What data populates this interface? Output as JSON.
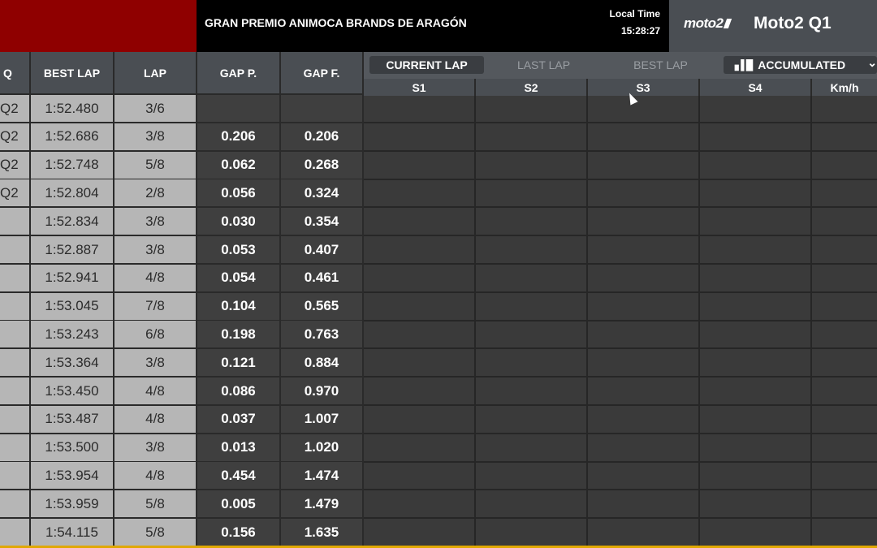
{
  "header": {
    "event_title": "GRAN PREMIO ANIMOCA BRANDS DE ARAGÓN",
    "local_time_label": "Local Time",
    "local_time_value": "15:28:27",
    "series_logo": "moto2",
    "session_title": "Moto2 Q1"
  },
  "columns": {
    "q": "Q",
    "best_lap": "BEST LAP",
    "lap": "LAP",
    "gap_p": "GAP P.",
    "gap_f": "GAP F."
  },
  "tabs": {
    "current": "CURRENT LAP",
    "last": "LAST LAP",
    "best": "BEST LAP",
    "accumulated": "ACCUMULATED"
  },
  "sectors": [
    "S1",
    "S2",
    "S3",
    "S4",
    "Km/h"
  ],
  "rows": [
    {
      "q": "Q2",
      "best": "1:52.480",
      "lap": "3/6",
      "gap_p": "",
      "gap_f": ""
    },
    {
      "q": "Q2",
      "best": "1:52.686",
      "lap": "3/8",
      "gap_p": "0.206",
      "gap_f": "0.206"
    },
    {
      "q": "Q2",
      "best": "1:52.748",
      "lap": "5/8",
      "gap_p": "0.062",
      "gap_f": "0.268"
    },
    {
      "q": "Q2",
      "best": "1:52.804",
      "lap": "2/8",
      "gap_p": "0.056",
      "gap_f": "0.324"
    },
    {
      "q": "",
      "best": "1:52.834",
      "lap": "3/8",
      "gap_p": "0.030",
      "gap_f": "0.354"
    },
    {
      "q": "",
      "best": "1:52.887",
      "lap": "3/8",
      "gap_p": "0.053",
      "gap_f": "0.407"
    },
    {
      "q": "",
      "best": "1:52.941",
      "lap": "4/8",
      "gap_p": "0.054",
      "gap_f": "0.461"
    },
    {
      "q": "",
      "best": "1:53.045",
      "lap": "7/8",
      "gap_p": "0.104",
      "gap_f": "0.565"
    },
    {
      "q": "",
      "best": "1:53.243",
      "lap": "6/8",
      "gap_p": "0.198",
      "gap_f": "0.763"
    },
    {
      "q": "",
      "best": "1:53.364",
      "lap": "3/8",
      "gap_p": "0.121",
      "gap_f": "0.884"
    },
    {
      "q": "",
      "best": "1:53.450",
      "lap": "4/8",
      "gap_p": "0.086",
      "gap_f": "0.970"
    },
    {
      "q": "",
      "best": "1:53.487",
      "lap": "4/8",
      "gap_p": "0.037",
      "gap_f": "1.007"
    },
    {
      "q": "",
      "best": "1:53.500",
      "lap": "3/8",
      "gap_p": "0.013",
      "gap_f": "1.020"
    },
    {
      "q": "",
      "best": "1:53.954",
      "lap": "4/8",
      "gap_p": "0.454",
      "gap_f": "1.474"
    },
    {
      "q": "",
      "best": "1:53.959",
      "lap": "5/8",
      "gap_p": "0.005",
      "gap_f": "1.479"
    },
    {
      "q": "",
      "best": "1:54.115",
      "lap": "5/8",
      "gap_p": "0.156",
      "gap_f": "1.635"
    }
  ],
  "colors": {
    "header_red": "#8f0000",
    "light_cell": "#b6b6b6",
    "dark_cell": "#3f3f3f",
    "accent_strip": "#e0a800"
  }
}
